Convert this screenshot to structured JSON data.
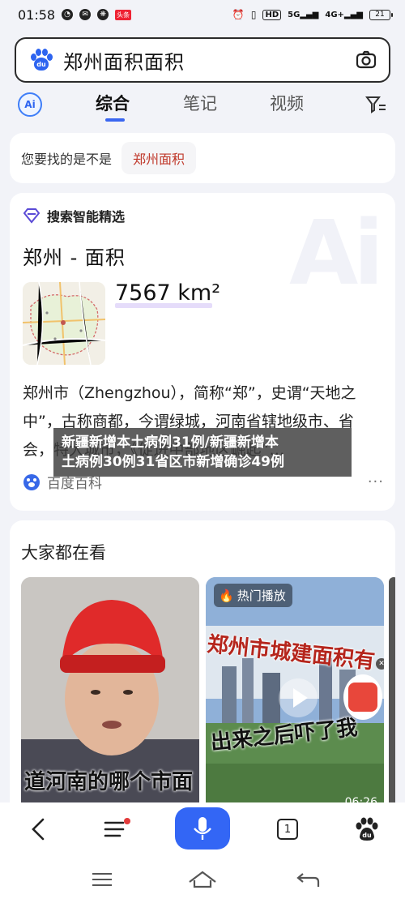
{
  "status_bar": {
    "time": "01:58",
    "left_badge": "头条",
    "hd_label": "HD",
    "sig1": "5G",
    "sig2": "4G+",
    "battery": "21"
  },
  "search": {
    "query": "郑州面积面积"
  },
  "tabs": [
    {
      "label": "综合",
      "active": true
    },
    {
      "label": "笔记",
      "active": false
    },
    {
      "label": "视频",
      "active": false
    }
  ],
  "ai_badge": "Ai",
  "suggestion": {
    "prefix": "您要找的是不是",
    "chip": "郑州面积"
  },
  "ai_card": {
    "header": "搜索智能精选",
    "title": "郑州 - 面积",
    "area_value": "7567 km²",
    "description": "郑州市（Zhengzhou），简称“郑”，史谓“天地之中”，古称商都，今谓绿城，河南省辖地级市、省会，特大城市，《促进中部地区崛起“…",
    "source": "百度百科",
    "more": "···"
  },
  "popular": {
    "title": "大家都在看",
    "videos": [
      {
        "caption": "道河南的哪个市面"
      },
      {
        "tag": "热门播放",
        "caption_top": "郑州市城建面积有",
        "caption_bottom": "出来之后吓了我",
        "duration": "06:26"
      }
    ]
  },
  "news_overlay": {
    "line1": "新疆新增本土病例31例/新疆新增本",
    "line2": "土病例30例31省区市新增确诊49例"
  },
  "toolbar": {
    "tab_count": "1"
  },
  "colors": {
    "accent": "#3366f5",
    "chip_text": "#c0392b"
  }
}
